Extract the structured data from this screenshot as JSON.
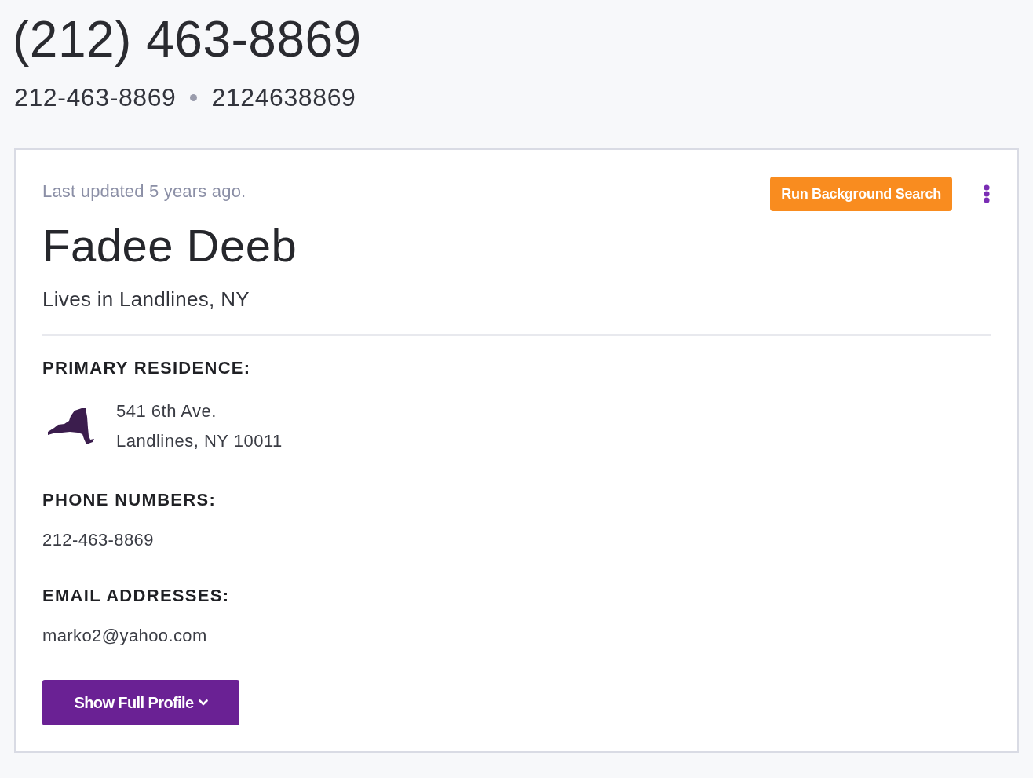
{
  "header": {
    "phone_formatted": "(212) 463-8869",
    "phone_variants": [
      "212-463-8869",
      "2124638869"
    ]
  },
  "card": {
    "last_updated": "Last updated 5 years ago.",
    "action_button": "Run Background Search",
    "name": "Fadee Deeb",
    "location": "Lives in Landlines, NY",
    "sections": [
      {
        "kind": "address",
        "heading": "PRIMARY RESIDENCE:",
        "lines": [
          "541 6th Ave.",
          "Landlines, NY 10011"
        ]
      },
      {
        "kind": "list",
        "heading": "PHONE NUMBERS:",
        "items": [
          "212-463-8869"
        ]
      },
      {
        "kind": "list",
        "heading": "EMAIL ADDRESSES:",
        "items": [
          "marko2@yahoo.com"
        ]
      }
    ],
    "expand_button": "Show Full Profile"
  }
}
